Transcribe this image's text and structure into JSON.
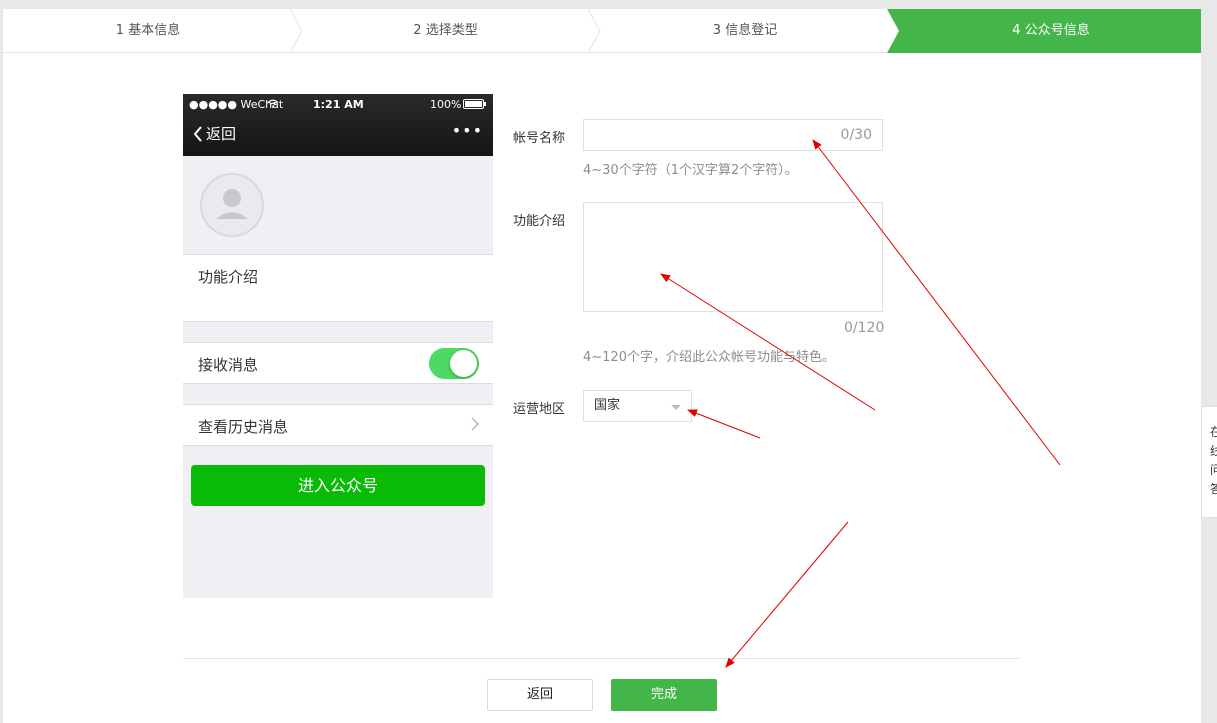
{
  "steps": [
    {
      "label": "1 基本信息",
      "active": false
    },
    {
      "label": "2 选择类型",
      "active": false
    },
    {
      "label": "3 信息登记",
      "active": false
    },
    {
      "label": "4 公众号信息",
      "active": true
    }
  ],
  "phone": {
    "signal": "●●●●● WeChat",
    "time": "1:21 AM",
    "battery": "100%",
    "back_label": "返回",
    "more": "•••",
    "intro_label": "功能介绍",
    "receive_label": "接收消息",
    "history_label": "查看历史消息",
    "enter_button": "进入公众号"
  },
  "form": {
    "name_label": "帐号名称",
    "name_value": "",
    "name_counter": "0/30",
    "name_hint": "4~30个字符（1个汉字算2个字符）。",
    "intro_label": "功能介绍",
    "intro_value": "",
    "intro_counter": "0/120",
    "intro_hint": "4~120个字，介绍此公众帐号功能与特色。",
    "region_label": "运营地区",
    "region_value": "国家"
  },
  "actions": {
    "back": "返回",
    "done": "完成"
  },
  "side_tip": [
    "在",
    "线",
    "问",
    "答"
  ],
  "colors": {
    "accent": "#44b549",
    "wechat_green": "#09bb07",
    "toggle_on": "#4cd964",
    "annotation_arrow": "#e00000"
  }
}
